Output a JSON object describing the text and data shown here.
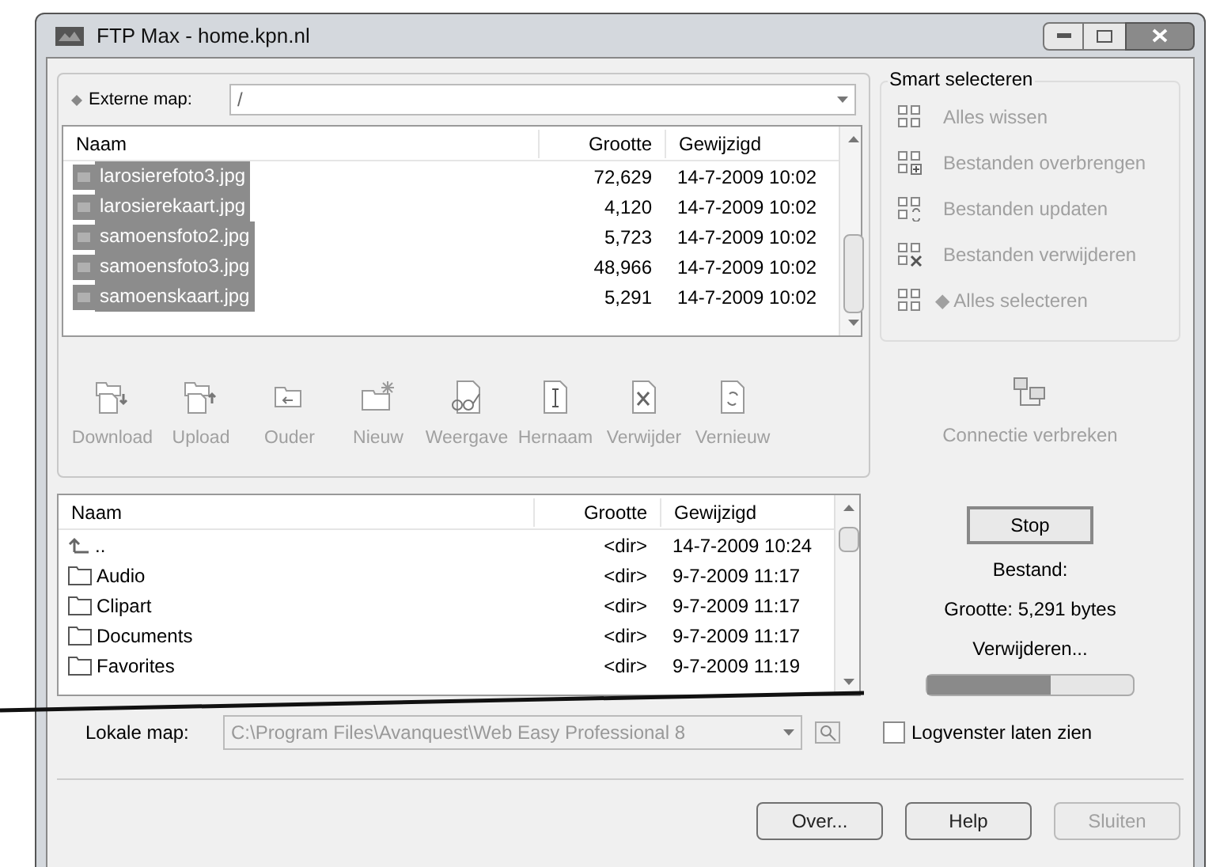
{
  "window": {
    "title": "FTP Max - home.kpn.nl"
  },
  "remote": {
    "label": "Externe map:",
    "path": "/",
    "columns": [
      "Naam",
      "Grootte",
      "Gewijzigd"
    ],
    "rows": [
      {
        "name": "larosierefoto3.jpg",
        "size": "72,629",
        "modified": "14-7-2009 10:02",
        "selected": true
      },
      {
        "name": "larosierekaart.jpg",
        "size": "4,120",
        "modified": "14-7-2009 10:02",
        "selected": true
      },
      {
        "name": "samoensfoto2.jpg",
        "size": "5,723",
        "modified": "14-7-2009 10:02",
        "selected": true
      },
      {
        "name": "samoensfoto3.jpg",
        "size": "48,966",
        "modified": "14-7-2009 10:02",
        "selected": true
      },
      {
        "name": "samoenskaart.jpg",
        "size": "5,291",
        "modified": "14-7-2009 10:02",
        "selected": true
      }
    ]
  },
  "toolbar": [
    {
      "label": "Download",
      "kind": "download",
      "disabled": true
    },
    {
      "label": "Upload",
      "kind": "upload",
      "disabled": true
    },
    {
      "label": "Ouder",
      "kind": "parent",
      "disabled": true
    },
    {
      "label": "Nieuw",
      "kind": "new",
      "disabled": true
    },
    {
      "label": "Weergave",
      "kind": "view",
      "disabled": true
    },
    {
      "label": "Hernaam",
      "kind": "rename",
      "disabled": true
    },
    {
      "label": "Verwijder",
      "kind": "delete",
      "disabled": true
    },
    {
      "label": "Vernieuw",
      "kind": "refresh",
      "disabled": true
    }
  ],
  "local": {
    "columns": [
      "Naam",
      "Grootte",
      "Gewijzigd"
    ],
    "rows": [
      {
        "kind": "up",
        "name": "..",
        "size": "<dir>",
        "modified": "14-7-2009 10:24"
      },
      {
        "kind": "folder",
        "name": "Audio",
        "size": "<dir>",
        "modified": "9-7-2009 11:17"
      },
      {
        "kind": "folder",
        "name": "Clipart",
        "size": "<dir>",
        "modified": "9-7-2009 11:17"
      },
      {
        "kind": "folder",
        "name": "Documents",
        "size": "<dir>",
        "modified": "9-7-2009 11:17"
      },
      {
        "kind": "folder",
        "name": "Favorites",
        "size": "<dir>",
        "modified": "9-7-2009 11:19"
      }
    ],
    "label": "Lokale map:",
    "path": "C:\\Program Files\\Avanquest\\Web Easy Professional 8"
  },
  "smart": {
    "title": "Smart selecteren",
    "items": [
      {
        "label": "Alles wissen",
        "kind": "clear",
        "disabled": true
      },
      {
        "label": "Bestanden overbrengen",
        "kind": "transfer",
        "disabled": true
      },
      {
        "label": "Bestanden updaten",
        "kind": "update",
        "disabled": true
      },
      {
        "label": "Bestanden verwijderen",
        "kind": "delete",
        "disabled": true
      },
      {
        "label": "◆ Alles selecteren",
        "kind": "all",
        "disabled": true
      }
    ]
  },
  "disconnect": {
    "label": "Connectie verbreken",
    "disabled": true
  },
  "transfer": {
    "stop": "Stop",
    "file": "Bestand:",
    "size": "Grootte: 5,291 bytes",
    "status": "Verwijderen...",
    "level": 0.6
  },
  "log": {
    "label": "Logvenster laten zien",
    "checked": false
  },
  "buttons": [
    {
      "label": "Over...",
      "disabled": false
    },
    {
      "label": "Help",
      "disabled": false
    },
    {
      "label": "Sluiten",
      "disabled": true
    }
  ]
}
